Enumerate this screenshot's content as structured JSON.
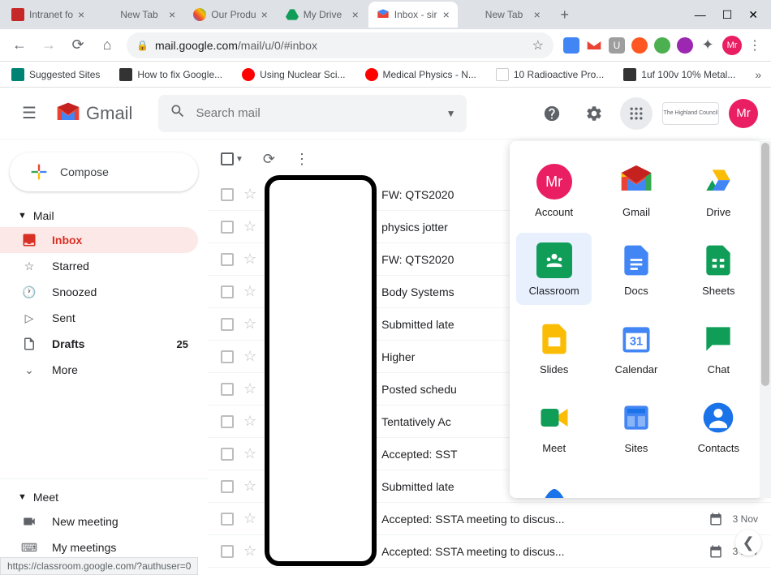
{
  "browser": {
    "tabs": [
      {
        "title": "Intranet fo",
        "favicon": "#c62828"
      },
      {
        "title": "New Tab",
        "favicon": "transparent"
      },
      {
        "title": "Our Produ",
        "favicon": "#4285f4"
      },
      {
        "title": "My Drive",
        "favicon": "#0f9d58"
      },
      {
        "title": "Inbox - sir",
        "favicon": "#ea4335",
        "active": true
      },
      {
        "title": "New Tab",
        "favicon": "transparent"
      }
    ],
    "url_host": "mail.google.com",
    "url_path": "/mail/u/0/#inbox",
    "avatar_text": "Mr",
    "bookmarks": [
      {
        "label": "Suggested Sites",
        "color": "#008373"
      },
      {
        "label": "How to fix Google...",
        "color": "#333"
      },
      {
        "label": "Using Nuclear Sci...",
        "color": "#ff0000"
      },
      {
        "label": "Medical Physics - N...",
        "color": "#ff0000"
      },
      {
        "label": "10 Radioactive Pro...",
        "color": "#333"
      },
      {
        "label": "1uf 100v 10% Metal...",
        "color": "#333"
      }
    ]
  },
  "gmail": {
    "logo_text": "Gmail",
    "search_placeholder": "Search mail",
    "compose_label": "Compose",
    "avatar_text": "Mr",
    "council_text": "The Highland Council",
    "sections": {
      "mail_header": "Mail",
      "meet_header": "Meet"
    },
    "nav": [
      {
        "label": "Inbox",
        "icon": "inbox",
        "active": true
      },
      {
        "label": "Starred",
        "icon": "star"
      },
      {
        "label": "Snoozed",
        "icon": "clock"
      },
      {
        "label": "Sent",
        "icon": "send"
      },
      {
        "label": "Drafts",
        "icon": "file",
        "count": "25",
        "bold": true
      },
      {
        "label": "More",
        "icon": "chevron"
      }
    ],
    "meet_nav": [
      {
        "label": "New meeting",
        "icon": "video-plus"
      },
      {
        "label": "My meetings",
        "icon": "keyboard"
      }
    ],
    "mails": [
      {
        "subject": "FW: QTS2020"
      },
      {
        "subject": "physics jotter"
      },
      {
        "subject": "FW: QTS2020"
      },
      {
        "subject": "Body Systems"
      },
      {
        "subject": "Submitted late"
      },
      {
        "subject": "Higher"
      },
      {
        "subject": "Posted schedu"
      },
      {
        "subject": "Tentatively Ac"
      },
      {
        "subject": "Accepted: SST"
      },
      {
        "subject": "Submitted late"
      },
      {
        "subject": "Accepted: SSTA meeting to discus...",
        "date": "3 Nov",
        "cal": true
      },
      {
        "subject": "Accepted: SSTA meeting to discus...",
        "date": "3 Nov",
        "cal": true
      }
    ]
  },
  "apps": [
    {
      "label": "Account",
      "type": "account"
    },
    {
      "label": "Gmail",
      "type": "gmail"
    },
    {
      "label": "Drive",
      "type": "drive"
    },
    {
      "label": "Classroom",
      "type": "classroom",
      "highlighted": true
    },
    {
      "label": "Docs",
      "type": "docs"
    },
    {
      "label": "Sheets",
      "type": "sheets"
    },
    {
      "label": "Slides",
      "type": "slides"
    },
    {
      "label": "Calendar",
      "type": "calendar"
    },
    {
      "label": "Chat",
      "type": "chat"
    },
    {
      "label": "Meet",
      "type": "meet"
    },
    {
      "label": "Sites",
      "type": "sites"
    },
    {
      "label": "Contacts",
      "type": "contacts"
    }
  ],
  "status_url": "https://classroom.google.com/?authuser=0"
}
